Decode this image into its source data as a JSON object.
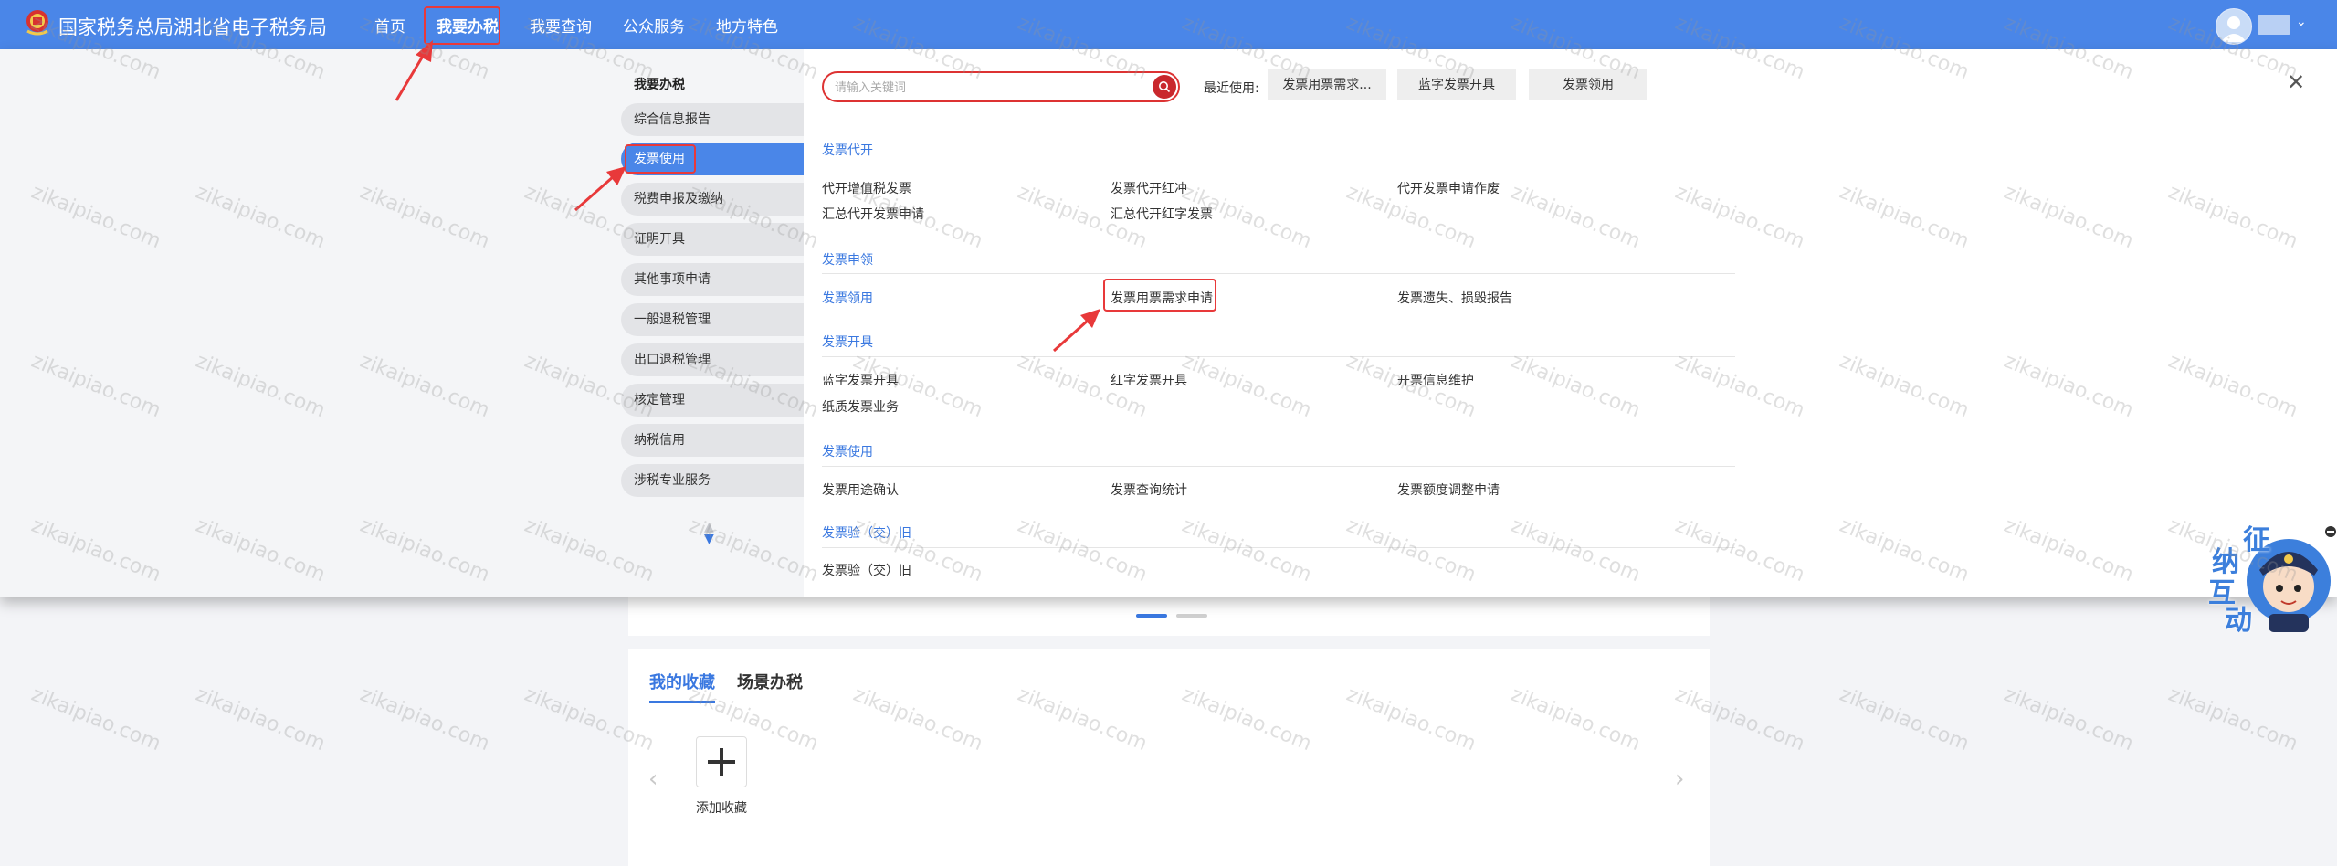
{
  "header": {
    "site_title": "国家税务总局湖北省电子税务局",
    "nav": [
      {
        "label": "首页"
      },
      {
        "label": "我要办税"
      },
      {
        "label": "我要查询"
      },
      {
        "label": "公众服务"
      },
      {
        "label": "地方特色"
      }
    ]
  },
  "menu": {
    "left_title": "我要办税",
    "left_items": [
      {
        "label": "综合信息报告"
      },
      {
        "label": "发票使用"
      },
      {
        "label": "税费申报及缴纳"
      },
      {
        "label": "证明开具"
      },
      {
        "label": "其他事项申请"
      },
      {
        "label": "一般退税管理"
      },
      {
        "label": "出口退税管理"
      },
      {
        "label": "核定管理"
      },
      {
        "label": "纳税信用"
      },
      {
        "label": "涉税专业服务"
      }
    ],
    "search": {
      "placeholder": "请输入关键词",
      "value": ""
    },
    "recent_label": "最近使用:",
    "recent": [
      {
        "label": "发票用票需求..."
      },
      {
        "label": "蓝字发票开具"
      },
      {
        "label": "发票领用"
      }
    ],
    "sections": [
      {
        "title": "发票代开",
        "links": [
          {
            "label": "代开增值税发票"
          },
          {
            "label": "发票代开红冲"
          },
          {
            "label": "代开发票申请作废"
          },
          {
            "label": "汇总代开发票申请"
          },
          {
            "label": "汇总代开红字发票"
          }
        ]
      },
      {
        "title": "发票申领",
        "links": [
          {
            "label": "发票领用"
          },
          {
            "label": "发票用票需求申请"
          },
          {
            "label": "发票遗失、损毁报告"
          }
        ]
      },
      {
        "title": "发票开具",
        "links": [
          {
            "label": "蓝字发票开具"
          },
          {
            "label": "红字发票开具"
          },
          {
            "label": "开票信息维护"
          },
          {
            "label": "纸质发票业务"
          }
        ]
      },
      {
        "title": "发票使用",
        "links": [
          {
            "label": "发票用途确认"
          },
          {
            "label": "发票查询统计"
          },
          {
            "label": "发票额度调整申请"
          }
        ]
      },
      {
        "title": "发票验（交）旧",
        "links": [
          {
            "label": "发票验（交）旧"
          }
        ]
      }
    ]
  },
  "favorites": {
    "tabs": [
      {
        "label": "我的收藏"
      },
      {
        "label": "场景办税"
      }
    ],
    "add_label": "添加收藏"
  },
  "mascot": {
    "text_chars": [
      "征",
      "纳",
      "互",
      "动"
    ]
  },
  "watermark": "zikaipiao.com",
  "colors": {
    "header_blue": "#4a86e8",
    "link_blue": "#3a78e0",
    "annotation_red": "#e8393a"
  }
}
